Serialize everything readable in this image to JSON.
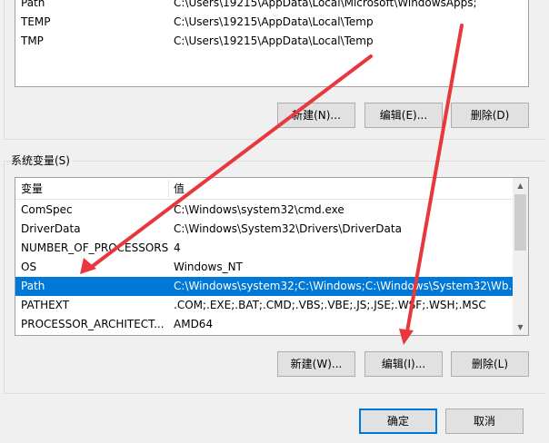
{
  "user_vars": {
    "rows": [
      {
        "name": "Path",
        "value": "C:\\Users\\19215\\AppData\\Local\\Microsoft\\WindowsApps;"
      },
      {
        "name": "TEMP",
        "value": "C:\\Users\\19215\\AppData\\Local\\Temp"
      },
      {
        "name": "TMP",
        "value": "C:\\Users\\19215\\AppData\\Local\\Temp"
      }
    ],
    "buttons": {
      "new": "新建(N)...",
      "edit": "编辑(E)...",
      "delete": "删除(D)"
    }
  },
  "sys_vars": {
    "group_label": "系统变量(S)",
    "headers": {
      "name": "变量",
      "value": "值"
    },
    "rows": [
      {
        "name": "ComSpec",
        "value": "C:\\Windows\\system32\\cmd.exe"
      },
      {
        "name": "DriverData",
        "value": "C:\\Windows\\System32\\Drivers\\DriverData"
      },
      {
        "name": "NUMBER_OF_PROCESSORS",
        "value": "4"
      },
      {
        "name": "OS",
        "value": "Windows_NT"
      },
      {
        "name": "Path",
        "value": "C:\\Windows\\system32;C:\\Windows;C:\\Windows\\System32\\Wb..."
      },
      {
        "name": "PATHEXT",
        "value": ".COM;.EXE;.BAT;.CMD;.VBS;.VBE;.JS;.JSE;.WSF;.WSH;.MSC"
      },
      {
        "name": "PROCESSOR_ARCHITECT...",
        "value": "AMD64"
      }
    ],
    "selected_row": "Path",
    "buttons": {
      "new": "新建(W)...",
      "edit": "编辑(I)...",
      "delete": "删除(L)"
    }
  },
  "dialog_buttons": {
    "ok": "确定",
    "cancel": "取消"
  },
  "colors": {
    "selection": "#0078d7",
    "annotation_arrow": "#e8383d"
  },
  "icons": {
    "scroll_up": "▲",
    "scroll_down": "▼"
  }
}
